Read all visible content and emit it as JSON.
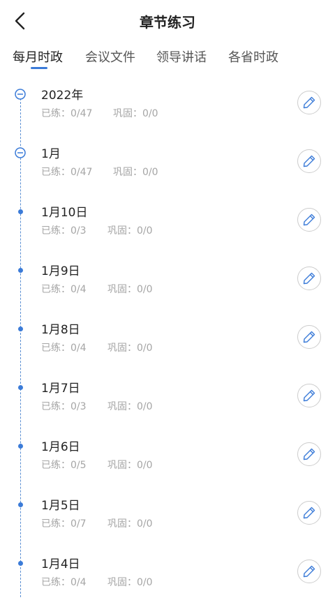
{
  "header": {
    "title": "章节练习",
    "back_icon": "chevron-left-icon"
  },
  "tabs": [
    {
      "label": "每月时政",
      "active": true
    },
    {
      "label": "会议文件",
      "active": false
    },
    {
      "label": "领导讲话",
      "active": false
    },
    {
      "label": "各省时政",
      "active": false
    }
  ],
  "colors": {
    "accent": "#3b7bd8",
    "muted_text": "#a5a5a5",
    "border": "#cccccc"
  },
  "rows": [
    {
      "title": "2022年",
      "practiced": "已练：0/47",
      "reviewed": "巩固：0/0",
      "node": "circle-minus-icon",
      "action_icon": "pencil-icon"
    },
    {
      "title": "1月",
      "practiced": "已练：0/47",
      "reviewed": "巩固：0/0",
      "node": "circle-minus-icon",
      "action_icon": "pencil-icon"
    },
    {
      "title": "1月10日",
      "practiced": "已练：0/3",
      "reviewed": "巩固：0/0",
      "node": "dot",
      "action_icon": "pencil-icon"
    },
    {
      "title": "1月9日",
      "practiced": "已练：0/4",
      "reviewed": "巩固：0/0",
      "node": "dot",
      "action_icon": "pencil-icon"
    },
    {
      "title": "1月8日",
      "practiced": "已练：0/4",
      "reviewed": "巩固：0/0",
      "node": "dot",
      "action_icon": "pencil-icon"
    },
    {
      "title": "1月7日",
      "practiced": "已练：0/3",
      "reviewed": "巩固：0/0",
      "node": "dot",
      "action_icon": "pencil-icon"
    },
    {
      "title": "1月6日",
      "practiced": "已练：0/5",
      "reviewed": "巩固：0/0",
      "node": "dot",
      "action_icon": "pencil-icon"
    },
    {
      "title": "1月5日",
      "practiced": "已练：0/7",
      "reviewed": "巩固：0/0",
      "node": "dot",
      "action_icon": "pencil-icon"
    },
    {
      "title": "1月4日",
      "practiced": "已练：0/4",
      "reviewed": "巩固：0/0",
      "node": "dot",
      "action_icon": "pencil-icon"
    }
  ]
}
